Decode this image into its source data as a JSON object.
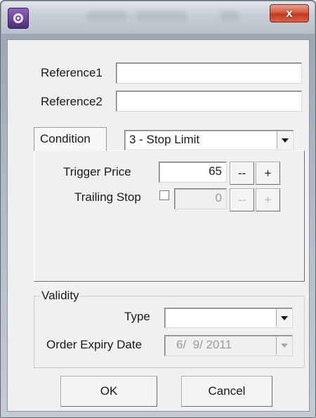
{
  "window": {
    "title": ""
  },
  "titlebar": {
    "close_label": "x"
  },
  "references": [
    {
      "label": "Reference1",
      "value": ""
    },
    {
      "label": "Reference2",
      "value": ""
    }
  ],
  "tab": {
    "label": "Condition"
  },
  "order_type": {
    "selected": "3 - Stop Limit"
  },
  "trigger_price": {
    "label": "Trigger Price",
    "value": "65",
    "decrement": "--",
    "increment": "+"
  },
  "trailing_stop": {
    "label": "Trailing Stop",
    "checked": false,
    "value": "0",
    "decrement": "--",
    "increment": "+"
  },
  "validity": {
    "title": "Validity",
    "type_label": "Type",
    "type_value": "",
    "expiry_label": "Order Expiry Date",
    "expiry_value": "6/  9/ 2011"
  },
  "buttons": {
    "ok": "OK",
    "cancel": "Cancel"
  }
}
